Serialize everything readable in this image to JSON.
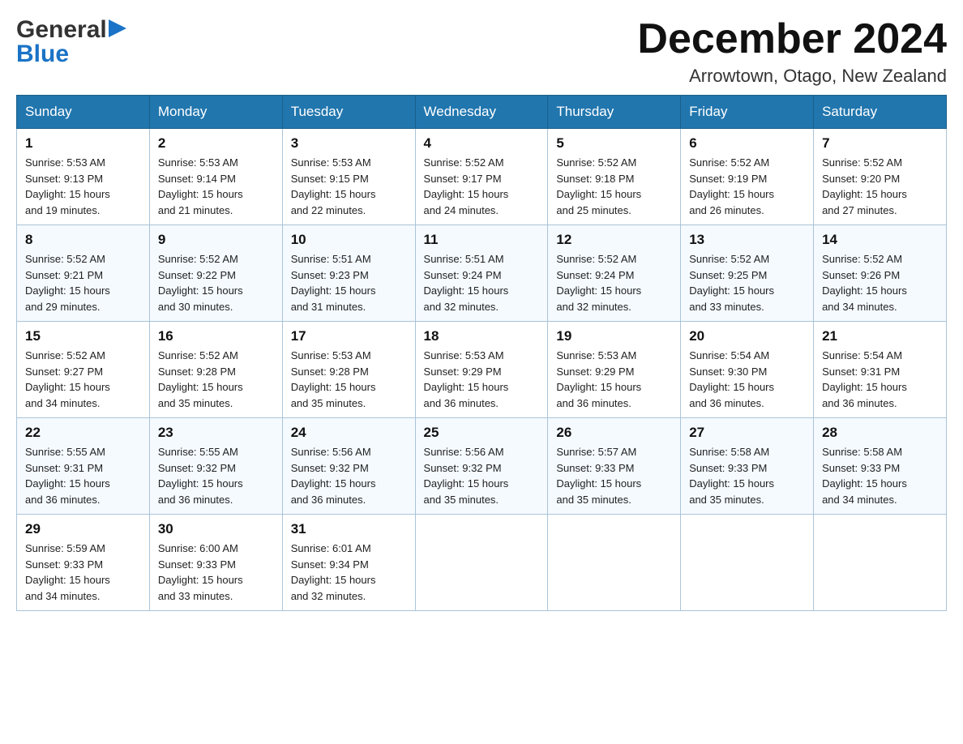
{
  "logo": {
    "general": "General",
    "blue": "Blue",
    "arrow_symbol": "▶"
  },
  "title": "December 2024",
  "subtitle": "Arrowtown, Otago, New Zealand",
  "days_of_week": [
    "Sunday",
    "Monday",
    "Tuesday",
    "Wednesday",
    "Thursday",
    "Friday",
    "Saturday"
  ],
  "weeks": [
    [
      {
        "day": "1",
        "sunrise": "5:53 AM",
        "sunset": "9:13 PM",
        "daylight": "15 hours and 19 minutes."
      },
      {
        "day": "2",
        "sunrise": "5:53 AM",
        "sunset": "9:14 PM",
        "daylight": "15 hours and 21 minutes."
      },
      {
        "day": "3",
        "sunrise": "5:53 AM",
        "sunset": "9:15 PM",
        "daylight": "15 hours and 22 minutes."
      },
      {
        "day": "4",
        "sunrise": "5:52 AM",
        "sunset": "9:17 PM",
        "daylight": "15 hours and 24 minutes."
      },
      {
        "day": "5",
        "sunrise": "5:52 AM",
        "sunset": "9:18 PM",
        "daylight": "15 hours and 25 minutes."
      },
      {
        "day": "6",
        "sunrise": "5:52 AM",
        "sunset": "9:19 PM",
        "daylight": "15 hours and 26 minutes."
      },
      {
        "day": "7",
        "sunrise": "5:52 AM",
        "sunset": "9:20 PM",
        "daylight": "15 hours and 27 minutes."
      }
    ],
    [
      {
        "day": "8",
        "sunrise": "5:52 AM",
        "sunset": "9:21 PM",
        "daylight": "15 hours and 29 minutes."
      },
      {
        "day": "9",
        "sunrise": "5:52 AM",
        "sunset": "9:22 PM",
        "daylight": "15 hours and 30 minutes."
      },
      {
        "day": "10",
        "sunrise": "5:51 AM",
        "sunset": "9:23 PM",
        "daylight": "15 hours and 31 minutes."
      },
      {
        "day": "11",
        "sunrise": "5:51 AM",
        "sunset": "9:24 PM",
        "daylight": "15 hours and 32 minutes."
      },
      {
        "day": "12",
        "sunrise": "5:52 AM",
        "sunset": "9:24 PM",
        "daylight": "15 hours and 32 minutes."
      },
      {
        "day": "13",
        "sunrise": "5:52 AM",
        "sunset": "9:25 PM",
        "daylight": "15 hours and 33 minutes."
      },
      {
        "day": "14",
        "sunrise": "5:52 AM",
        "sunset": "9:26 PM",
        "daylight": "15 hours and 34 minutes."
      }
    ],
    [
      {
        "day": "15",
        "sunrise": "5:52 AM",
        "sunset": "9:27 PM",
        "daylight": "15 hours and 34 minutes."
      },
      {
        "day": "16",
        "sunrise": "5:52 AM",
        "sunset": "9:28 PM",
        "daylight": "15 hours and 35 minutes."
      },
      {
        "day": "17",
        "sunrise": "5:53 AM",
        "sunset": "9:28 PM",
        "daylight": "15 hours and 35 minutes."
      },
      {
        "day": "18",
        "sunrise": "5:53 AM",
        "sunset": "9:29 PM",
        "daylight": "15 hours and 36 minutes."
      },
      {
        "day": "19",
        "sunrise": "5:53 AM",
        "sunset": "9:29 PM",
        "daylight": "15 hours and 36 minutes."
      },
      {
        "day": "20",
        "sunrise": "5:54 AM",
        "sunset": "9:30 PM",
        "daylight": "15 hours and 36 minutes."
      },
      {
        "day": "21",
        "sunrise": "5:54 AM",
        "sunset": "9:31 PM",
        "daylight": "15 hours and 36 minutes."
      }
    ],
    [
      {
        "day": "22",
        "sunrise": "5:55 AM",
        "sunset": "9:31 PM",
        "daylight": "15 hours and 36 minutes."
      },
      {
        "day": "23",
        "sunrise": "5:55 AM",
        "sunset": "9:32 PM",
        "daylight": "15 hours and 36 minutes."
      },
      {
        "day": "24",
        "sunrise": "5:56 AM",
        "sunset": "9:32 PM",
        "daylight": "15 hours and 36 minutes."
      },
      {
        "day": "25",
        "sunrise": "5:56 AM",
        "sunset": "9:32 PM",
        "daylight": "15 hours and 35 minutes."
      },
      {
        "day": "26",
        "sunrise": "5:57 AM",
        "sunset": "9:33 PM",
        "daylight": "15 hours and 35 minutes."
      },
      {
        "day": "27",
        "sunrise": "5:58 AM",
        "sunset": "9:33 PM",
        "daylight": "15 hours and 35 minutes."
      },
      {
        "day": "28",
        "sunrise": "5:58 AM",
        "sunset": "9:33 PM",
        "daylight": "15 hours and 34 minutes."
      }
    ],
    [
      {
        "day": "29",
        "sunrise": "5:59 AM",
        "sunset": "9:33 PM",
        "daylight": "15 hours and 34 minutes."
      },
      {
        "day": "30",
        "sunrise": "6:00 AM",
        "sunset": "9:33 PM",
        "daylight": "15 hours and 33 minutes."
      },
      {
        "day": "31",
        "sunrise": "6:01 AM",
        "sunset": "9:34 PM",
        "daylight": "15 hours and 32 minutes."
      },
      null,
      null,
      null,
      null
    ]
  ]
}
